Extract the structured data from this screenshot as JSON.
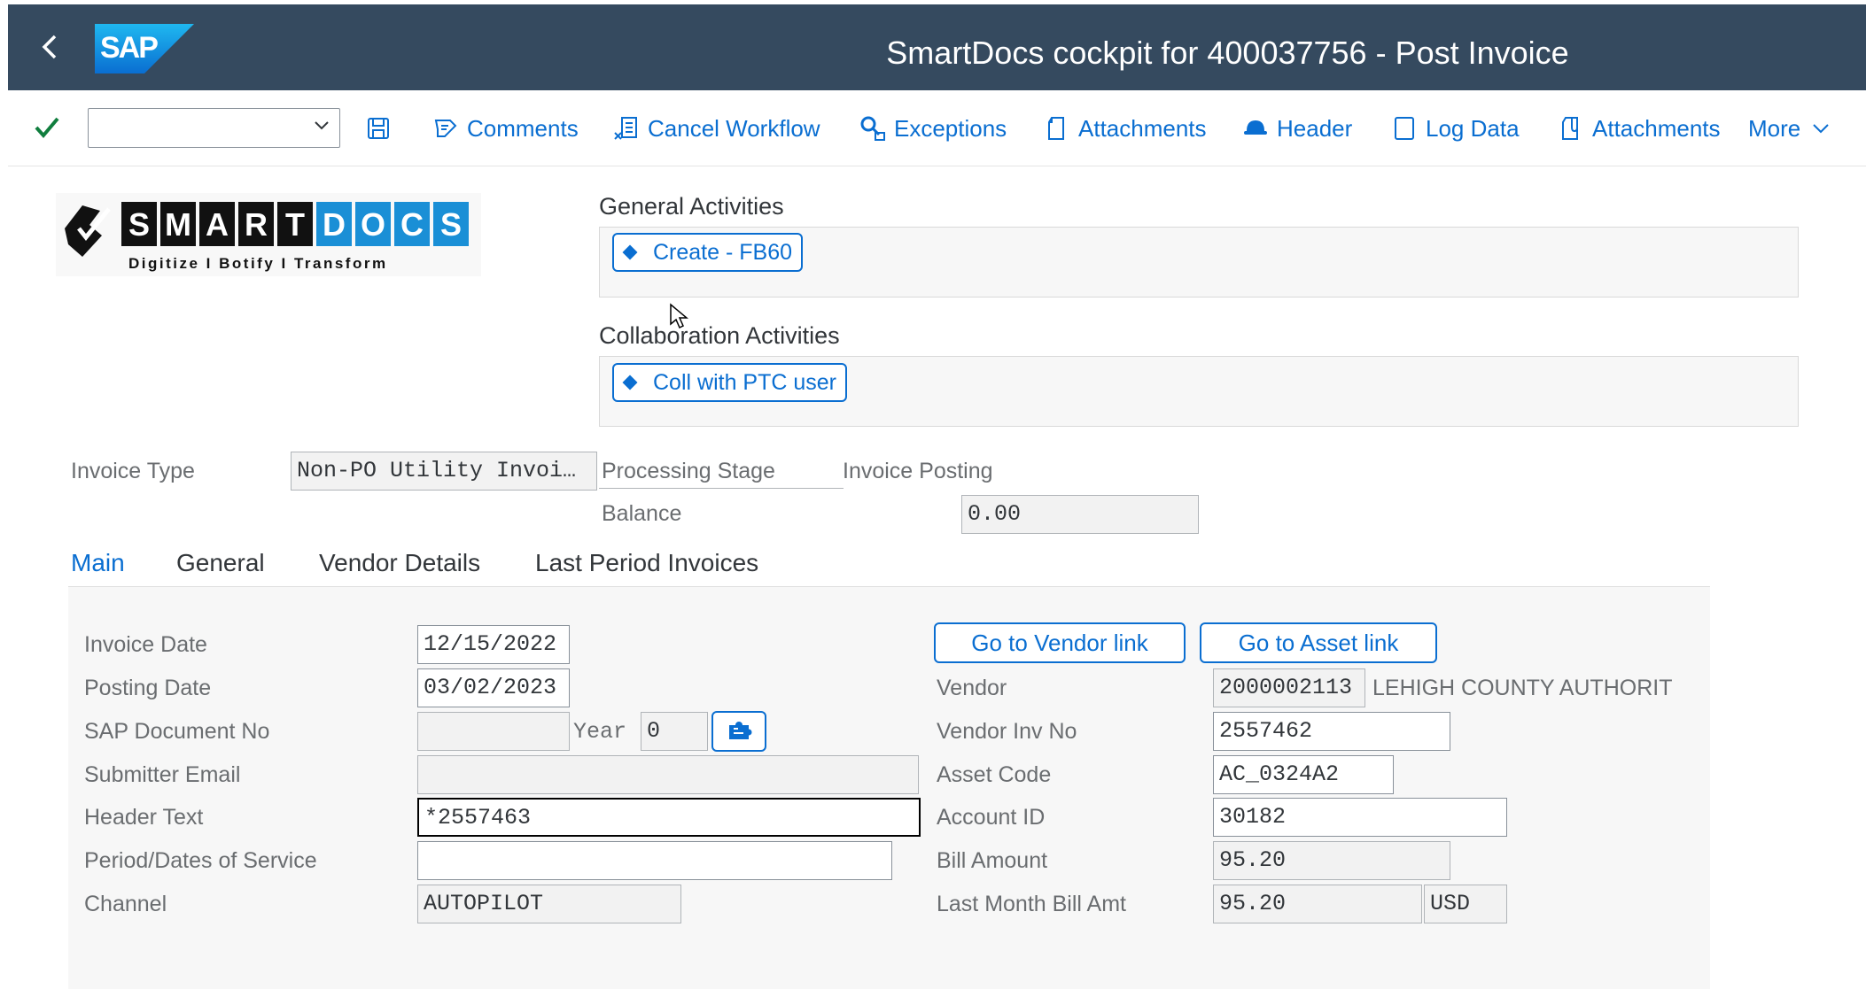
{
  "shell": {
    "title": "SmartDocs cockpit for 400037756 - Post Invoice",
    "logo_text": "SAP"
  },
  "toolbar": {
    "command_field": "",
    "items": [
      {
        "label": "Comments",
        "icon": "comments-icon"
      },
      {
        "label": "Cancel Workflow",
        "icon": "cancel-workflow-icon"
      },
      {
        "label": "Exceptions",
        "icon": "exceptions-icon"
      },
      {
        "label": "Attachments",
        "icon": "attachment-icon"
      },
      {
        "label": "Header",
        "icon": "header-icon"
      },
      {
        "label": "Log Data",
        "icon": "log-data-icon"
      },
      {
        "label": "Attachments",
        "icon": "paperclip-icon"
      },
      {
        "label": "More",
        "icon": "chevron-down-icon"
      }
    ]
  },
  "smartdocs_logo": {
    "letters": "SMARTDOCS",
    "tagline": "Digitize  I  Botify  I  Transform"
  },
  "general_activities": {
    "title": "General Activities",
    "button": "Create - FB60"
  },
  "collaboration_activities": {
    "title": "Collaboration Activities",
    "button": "Coll with PTC user"
  },
  "header_fields": {
    "invoice_type_label": "Invoice Type",
    "invoice_type_value": "Non-PO Utility Invoi…",
    "processing_stage_label": "Processing Stage",
    "processing_stage_value": "Invoice Posting",
    "balance_label": "Balance",
    "balance_value": "0.00"
  },
  "tabs": [
    "Main",
    "General",
    "Vendor Details",
    "Last Period Invoices"
  ],
  "main_tab": {
    "invoice_date_label": "Invoice Date",
    "invoice_date": "12/15/2022",
    "posting_date_label": "Posting Date",
    "posting_date": "03/02/2023",
    "sap_doc_label": "SAP Document No",
    "sap_doc": "",
    "year_label": "Year",
    "year": "0",
    "submitter_email_label": "Submitter Email",
    "submitter_email": "",
    "header_text_label": "Header Text",
    "header_text": "*2557463",
    "period_label": "Period/Dates of Service",
    "period": "",
    "channel_label": "Channel",
    "channel": "AUTOPILOT",
    "vendor_link_button": "Go to Vendor link",
    "asset_link_button": "Go to Asset link",
    "vendor_label": "Vendor",
    "vendor_id": "2000002113",
    "vendor_name": "LEHIGH COUNTY AUTHORIT",
    "vendor_inv_label": "Vendor Inv No",
    "vendor_inv": "2557462",
    "asset_code_label": "Asset Code",
    "asset_code": "AC_0324A2",
    "account_id_label": "Account ID",
    "account_id": "30182",
    "bill_amount_label": "Bill Amount",
    "bill_amount": "95.20",
    "last_month_label": "Last Month Bill Amt",
    "last_month_amount": "95.20",
    "currency": "USD"
  },
  "colors": {
    "shell": "#354a5f",
    "accent": "#0a6ed1",
    "success": "#107e3e"
  }
}
